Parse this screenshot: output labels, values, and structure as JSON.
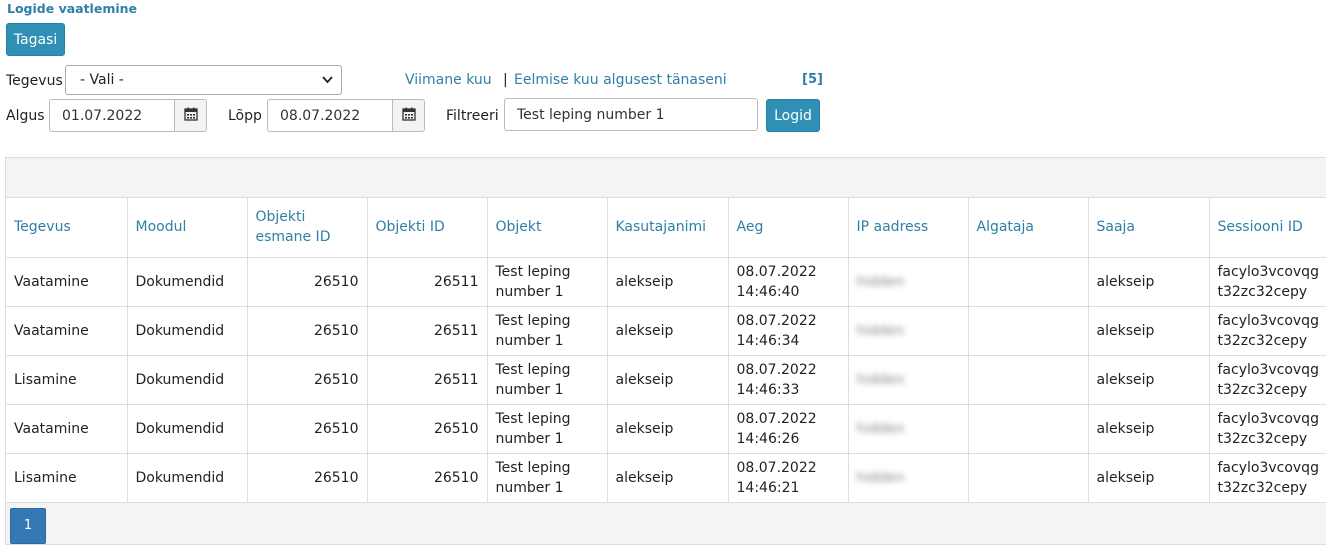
{
  "page": {
    "title": "Logide vaatlemine"
  },
  "toolbar": {
    "back_label": "Tagasi",
    "action_label": "Tegevus",
    "action_selected": "- Vali -",
    "last_month_link": "Viimane kuu",
    "separator": "|",
    "prev_month_link": "Eelmise kuu algusest tänaseni",
    "count": "[5]",
    "start_label": "Algus",
    "start_value": "01.07.2022",
    "end_label": "Lõpp",
    "end_value": "08.07.2022",
    "filter_label": "Filtreeri",
    "filter_value": "Test leping number 1",
    "logs_button": "Logid"
  },
  "table": {
    "headers": [
      "Tegevus",
      "Moodul",
      "Objekti esmane ID",
      "Objekti ID",
      "Objekt",
      "Kasutajanimi",
      "Aeg",
      "IP aadress",
      "Algataja",
      "Saaja",
      "Sessiooni ID"
    ],
    "rows": [
      {
        "action": "Vaatamine",
        "module": "Dokumendid",
        "primary_id": "26510",
        "object_id": "26511",
        "object": "Test leping number 1",
        "username": "alekseip",
        "time": "08.07.2022 14:46:40",
        "ip": "hidden",
        "initiator": "",
        "receiver": "alekseip",
        "session": "facylo3vcovqgt32zc32cepy"
      },
      {
        "action": "Vaatamine",
        "module": "Dokumendid",
        "primary_id": "26510",
        "object_id": "26511",
        "object": "Test leping number 1",
        "username": "alekseip",
        "time": "08.07.2022 14:46:34",
        "ip": "hidden",
        "initiator": "",
        "receiver": "alekseip",
        "session": "facylo3vcovqgt32zc32cepy"
      },
      {
        "action": "Lisamine",
        "module": "Dokumendid",
        "primary_id": "26510",
        "object_id": "26511",
        "object": "Test leping number 1",
        "username": "alekseip",
        "time": "08.07.2022 14:46:33",
        "ip": "hidden",
        "initiator": "",
        "receiver": "alekseip",
        "session": "facylo3vcovqgt32zc32cepy"
      },
      {
        "action": "Vaatamine",
        "module": "Dokumendid",
        "primary_id": "26510",
        "object_id": "26510",
        "object": "Test leping number 1",
        "username": "alekseip",
        "time": "08.07.2022 14:46:26",
        "ip": "hidden",
        "initiator": "",
        "receiver": "alekseip",
        "session": "facylo3vcovqgt32zc32cepy"
      },
      {
        "action": "Lisamine",
        "module": "Dokumendid",
        "primary_id": "26510",
        "object_id": "26510",
        "object": "Test leping number 1",
        "username": "alekseip",
        "time": "08.07.2022 14:46:21",
        "ip": "hidden",
        "initiator": "",
        "receiver": "alekseip",
        "session": "facylo3vcovqgt32zc32cepy"
      }
    ]
  },
  "pager": {
    "current": "1"
  },
  "icons": {
    "calendar": "calendar-icon",
    "dropdown": "chevron-down-icon"
  },
  "colors": {
    "accent": "#2f8fb5",
    "link": "#2f7fa8",
    "page_active": "#3479b4"
  }
}
